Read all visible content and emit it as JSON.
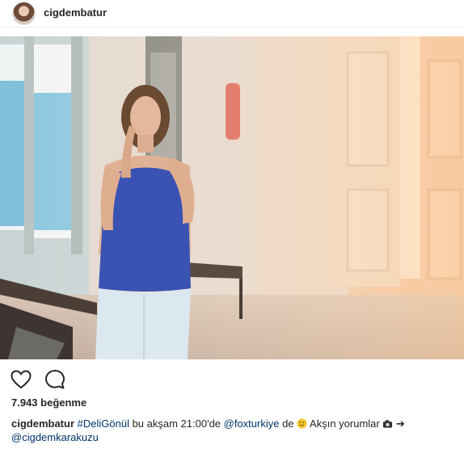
{
  "header": {
    "username": "cigdembatur"
  },
  "post": {
    "likes_text": "7.943 beğenme",
    "caption": {
      "username": "cigdembatur",
      "hashtag": "#DeliGönül",
      "text1": " bu akşam 21:00'de ",
      "mention1": "@foxturkiye",
      "text2": " de ",
      "text3": " Akşın yorumlar ",
      "arrow": "➔",
      "mention2": "@cigdemkarakuzu"
    }
  },
  "icons": {
    "like": "heart-icon",
    "comment": "comment-icon",
    "smile": "smiling-face-emoji",
    "camera": "camera-emoji"
  }
}
